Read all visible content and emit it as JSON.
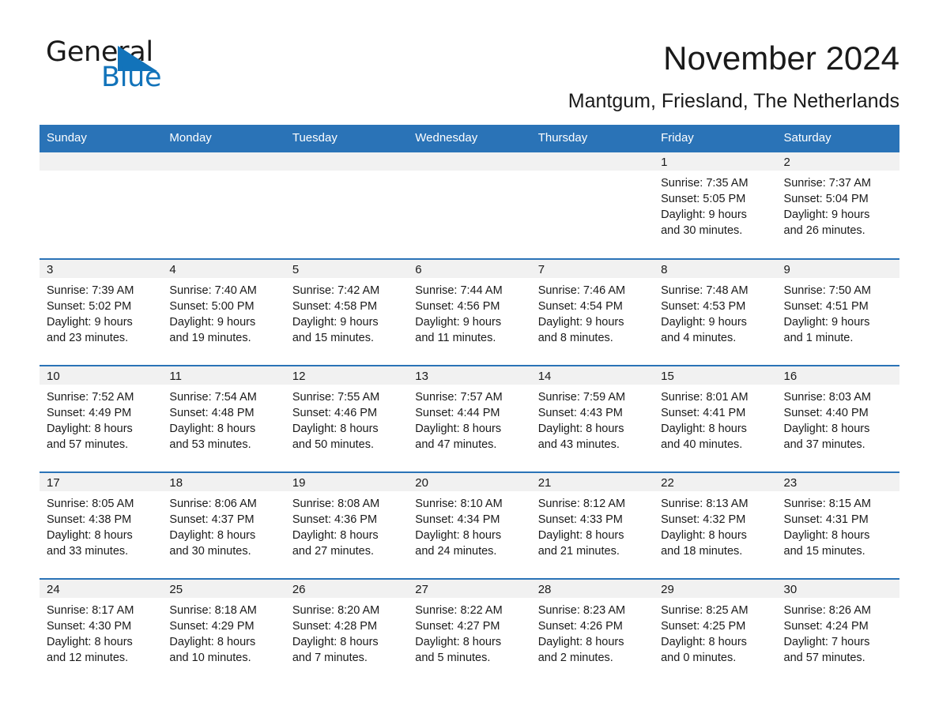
{
  "brand": {
    "name_part1": "General",
    "name_part2": "Blue",
    "triangle_icon": "triangle-icon",
    "accent_color": "#1273ba"
  },
  "header": {
    "title": "November 2024",
    "subtitle": "Mantgum, Friesland, The Netherlands"
  },
  "calendar": {
    "header_bg": "#2a73b7",
    "daynum_bg": "#f1f1f1",
    "weekday_headers": [
      "Sunday",
      "Monday",
      "Tuesday",
      "Wednesday",
      "Thursday",
      "Friday",
      "Saturday"
    ],
    "weeks": [
      [
        {
          "day": "",
          "lines": []
        },
        {
          "day": "",
          "lines": []
        },
        {
          "day": "",
          "lines": []
        },
        {
          "day": "",
          "lines": []
        },
        {
          "day": "",
          "lines": []
        },
        {
          "day": "1",
          "lines": [
            "Sunrise: 7:35 AM",
            "Sunset: 5:05 PM",
            "Daylight: 9 hours",
            "and 30 minutes."
          ]
        },
        {
          "day": "2",
          "lines": [
            "Sunrise: 7:37 AM",
            "Sunset: 5:04 PM",
            "Daylight: 9 hours",
            "and 26 minutes."
          ]
        }
      ],
      [
        {
          "day": "3",
          "lines": [
            "Sunrise: 7:39 AM",
            "Sunset: 5:02 PM",
            "Daylight: 9 hours",
            "and 23 minutes."
          ]
        },
        {
          "day": "4",
          "lines": [
            "Sunrise: 7:40 AM",
            "Sunset: 5:00 PM",
            "Daylight: 9 hours",
            "and 19 minutes."
          ]
        },
        {
          "day": "5",
          "lines": [
            "Sunrise: 7:42 AM",
            "Sunset: 4:58 PM",
            "Daylight: 9 hours",
            "and 15 minutes."
          ]
        },
        {
          "day": "6",
          "lines": [
            "Sunrise: 7:44 AM",
            "Sunset: 4:56 PM",
            "Daylight: 9 hours",
            "and 11 minutes."
          ]
        },
        {
          "day": "7",
          "lines": [
            "Sunrise: 7:46 AM",
            "Sunset: 4:54 PM",
            "Daylight: 9 hours",
            "and 8 minutes."
          ]
        },
        {
          "day": "8",
          "lines": [
            "Sunrise: 7:48 AM",
            "Sunset: 4:53 PM",
            "Daylight: 9 hours",
            "and 4 minutes."
          ]
        },
        {
          "day": "9",
          "lines": [
            "Sunrise: 7:50 AM",
            "Sunset: 4:51 PM",
            "Daylight: 9 hours",
            "and 1 minute."
          ]
        }
      ],
      [
        {
          "day": "10",
          "lines": [
            "Sunrise: 7:52 AM",
            "Sunset: 4:49 PM",
            "Daylight: 8 hours",
            "and 57 minutes."
          ]
        },
        {
          "day": "11",
          "lines": [
            "Sunrise: 7:54 AM",
            "Sunset: 4:48 PM",
            "Daylight: 8 hours",
            "and 53 minutes."
          ]
        },
        {
          "day": "12",
          "lines": [
            "Sunrise: 7:55 AM",
            "Sunset: 4:46 PM",
            "Daylight: 8 hours",
            "and 50 minutes."
          ]
        },
        {
          "day": "13",
          "lines": [
            "Sunrise: 7:57 AM",
            "Sunset: 4:44 PM",
            "Daylight: 8 hours",
            "and 47 minutes."
          ]
        },
        {
          "day": "14",
          "lines": [
            "Sunrise: 7:59 AM",
            "Sunset: 4:43 PM",
            "Daylight: 8 hours",
            "and 43 minutes."
          ]
        },
        {
          "day": "15",
          "lines": [
            "Sunrise: 8:01 AM",
            "Sunset: 4:41 PM",
            "Daylight: 8 hours",
            "and 40 minutes."
          ]
        },
        {
          "day": "16",
          "lines": [
            "Sunrise: 8:03 AM",
            "Sunset: 4:40 PM",
            "Daylight: 8 hours",
            "and 37 minutes."
          ]
        }
      ],
      [
        {
          "day": "17",
          "lines": [
            "Sunrise: 8:05 AM",
            "Sunset: 4:38 PM",
            "Daylight: 8 hours",
            "and 33 minutes."
          ]
        },
        {
          "day": "18",
          "lines": [
            "Sunrise: 8:06 AM",
            "Sunset: 4:37 PM",
            "Daylight: 8 hours",
            "and 30 minutes."
          ]
        },
        {
          "day": "19",
          "lines": [
            "Sunrise: 8:08 AM",
            "Sunset: 4:36 PM",
            "Daylight: 8 hours",
            "and 27 minutes."
          ]
        },
        {
          "day": "20",
          "lines": [
            "Sunrise: 8:10 AM",
            "Sunset: 4:34 PM",
            "Daylight: 8 hours",
            "and 24 minutes."
          ]
        },
        {
          "day": "21",
          "lines": [
            "Sunrise: 8:12 AM",
            "Sunset: 4:33 PM",
            "Daylight: 8 hours",
            "and 21 minutes."
          ]
        },
        {
          "day": "22",
          "lines": [
            "Sunrise: 8:13 AM",
            "Sunset: 4:32 PM",
            "Daylight: 8 hours",
            "and 18 minutes."
          ]
        },
        {
          "day": "23",
          "lines": [
            "Sunrise: 8:15 AM",
            "Sunset: 4:31 PM",
            "Daylight: 8 hours",
            "and 15 minutes."
          ]
        }
      ],
      [
        {
          "day": "24",
          "lines": [
            "Sunrise: 8:17 AM",
            "Sunset: 4:30 PM",
            "Daylight: 8 hours",
            "and 12 minutes."
          ]
        },
        {
          "day": "25",
          "lines": [
            "Sunrise: 8:18 AM",
            "Sunset: 4:29 PM",
            "Daylight: 8 hours",
            "and 10 minutes."
          ]
        },
        {
          "day": "26",
          "lines": [
            "Sunrise: 8:20 AM",
            "Sunset: 4:28 PM",
            "Daylight: 8 hours",
            "and 7 minutes."
          ]
        },
        {
          "day": "27",
          "lines": [
            "Sunrise: 8:22 AM",
            "Sunset: 4:27 PM",
            "Daylight: 8 hours",
            "and 5 minutes."
          ]
        },
        {
          "day": "28",
          "lines": [
            "Sunrise: 8:23 AM",
            "Sunset: 4:26 PM",
            "Daylight: 8 hours",
            "and 2 minutes."
          ]
        },
        {
          "day": "29",
          "lines": [
            "Sunrise: 8:25 AM",
            "Sunset: 4:25 PM",
            "Daylight: 8 hours",
            "and 0 minutes."
          ]
        },
        {
          "day": "30",
          "lines": [
            "Sunrise: 8:26 AM",
            "Sunset: 4:24 PM",
            "Daylight: 7 hours",
            "and 57 minutes."
          ]
        }
      ]
    ]
  }
}
